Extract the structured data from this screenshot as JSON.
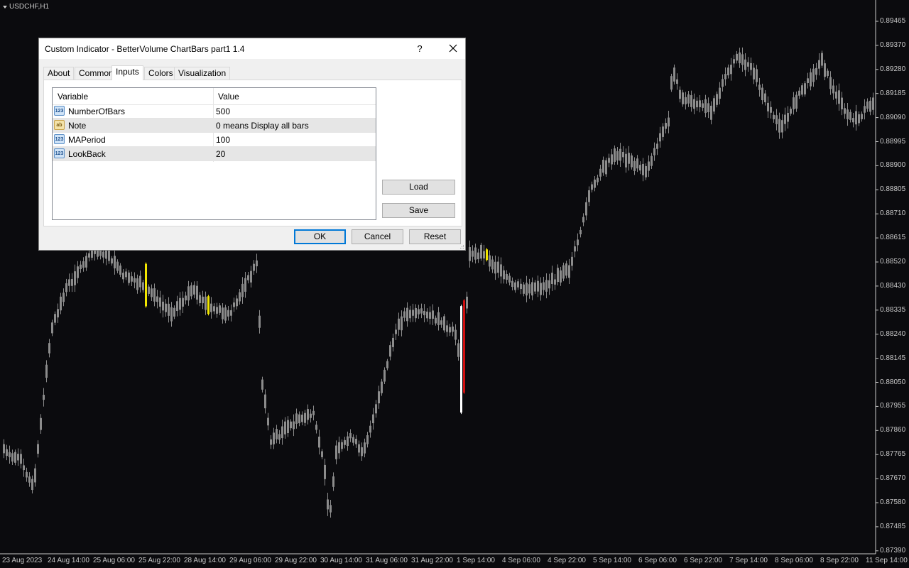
{
  "chart": {
    "symbol": "USDCHF,H1",
    "y_ticks": [
      "0.89465",
      "0.89370",
      "0.89280",
      "0.89185",
      "0.89090",
      "0.88995",
      "0.88900",
      "0.88805",
      "0.88710",
      "0.88615",
      "0.88520",
      "0.88430",
      "0.88335",
      "0.88240",
      "0.88145",
      "0.88050",
      "0.87955",
      "0.87860",
      "0.87765",
      "0.87670",
      "0.87580",
      "0.87485",
      "0.87390"
    ],
    "x_ticks": [
      "23 Aug 2023",
      "24 Aug 14:00",
      "25 Aug 06:00",
      "25 Aug 22:00",
      "28 Aug 14:00",
      "29 Aug 06:00",
      "29 Aug 22:00",
      "30 Aug 14:00",
      "31 Aug 06:00",
      "31 Aug 22:00",
      "1 Sep 14:00",
      "4 Sep 06:00",
      "4 Sep 22:00",
      "5 Sep 14:00",
      "6 Sep 06:00",
      "6 Sep 22:00",
      "7 Sep 14:00",
      "8 Sep 06:00",
      "8 Sep 22:00",
      "11 Sep 14:00"
    ],
    "colors": {
      "background": "#0b0b0e",
      "normal_bar": "#8c8c8c",
      "climax_bar": "#d10e0e",
      "high_volume_bar": "#ffffff",
      "low_volume_bar": "#f2e600"
    }
  },
  "dialog": {
    "title": "Custom Indicator - BetterVolume ChartBars part1 1.4",
    "help": "?",
    "tabs": [
      "About",
      "Common",
      "Inputs",
      "Colors",
      "Visualization"
    ],
    "active_tab": "Inputs",
    "grid_headers": {
      "variable": "Variable",
      "value": "Value"
    },
    "params": [
      {
        "type": "num",
        "icon_text": "123",
        "name": "NumberOfBars",
        "value": "500"
      },
      {
        "type": "str",
        "icon_text": "ab",
        "name": "Note",
        "value": "0 means Display all bars"
      },
      {
        "type": "num",
        "icon_text": "123",
        "name": "MAPeriod",
        "value": "100"
      },
      {
        "type": "num",
        "icon_text": "123",
        "name": "LookBack",
        "value": "20"
      }
    ],
    "buttons": {
      "load": "Load",
      "save": "Save",
      "ok": "OK",
      "cancel": "Cancel",
      "reset": "Reset"
    }
  }
}
